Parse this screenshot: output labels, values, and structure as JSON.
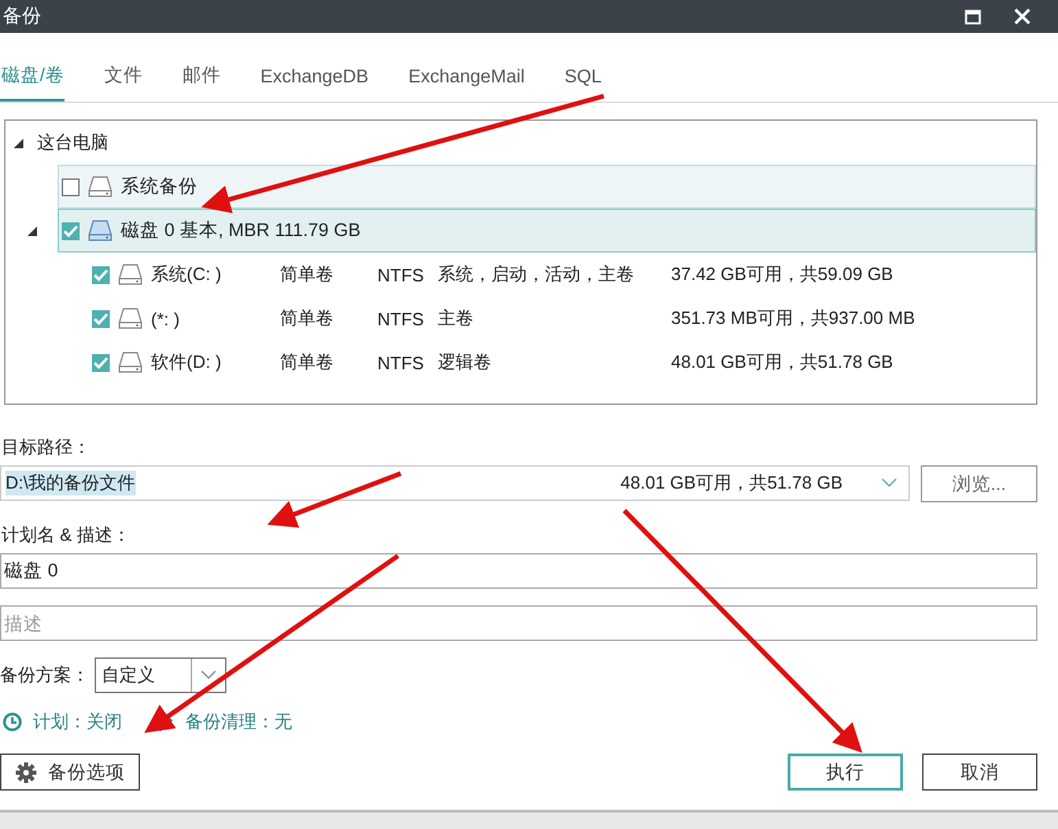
{
  "window": {
    "title": "备份"
  },
  "tabs": [
    {
      "label": "磁盘/卷",
      "selected": true
    },
    {
      "label": "文件",
      "selected": false
    },
    {
      "label": "邮件",
      "selected": false
    },
    {
      "label": "ExchangeDB",
      "selected": false
    },
    {
      "label": "ExchangeMail",
      "selected": false
    },
    {
      "label": "SQL",
      "selected": false
    }
  ],
  "tree": {
    "label": "这台电脑",
    "expanded": true,
    "children": [
      {
        "label": "系统备份",
        "checked": false,
        "selected": false
      },
      {
        "label": "磁盘 0 基本, MBR 111.79 GB",
        "checked": true,
        "selected": true,
        "expanded": true,
        "children": [
          {
            "name": "系统(C: )",
            "type": "简单卷",
            "fs": "NTFS",
            "flags": "系统，启动，活动，主卷",
            "space": "37.42 GB可用，共59.09 GB",
            "checked": true
          },
          {
            "name": "(*: )",
            "type": "简单卷",
            "fs": "NTFS",
            "flags": "主卷",
            "space": "351.73 MB可用，共937.00 MB",
            "checked": true
          },
          {
            "name": "软件(D: )",
            "type": "简单卷",
            "fs": "NTFS",
            "flags": "逻辑卷",
            "space": "48.01 GB可用，共51.78 GB",
            "checked": true
          }
        ]
      }
    ]
  },
  "target": {
    "label": "目标路径：",
    "path": "D:\\我的备份文件",
    "space": "48.01 GB可用，共51.78 GB",
    "browse": "浏览..."
  },
  "plan": {
    "label": "计划名 & 描述：",
    "name": "磁盘 0",
    "description_placeholder": "描述"
  },
  "scheme": {
    "label": "备份方案：",
    "value": "自定义"
  },
  "schedule": {
    "text": "计划：关闭"
  },
  "cleanup": {
    "text": "备份清理：无"
  },
  "buttons": {
    "options": "备份选项",
    "run": "执行",
    "cancel": "取消"
  }
}
